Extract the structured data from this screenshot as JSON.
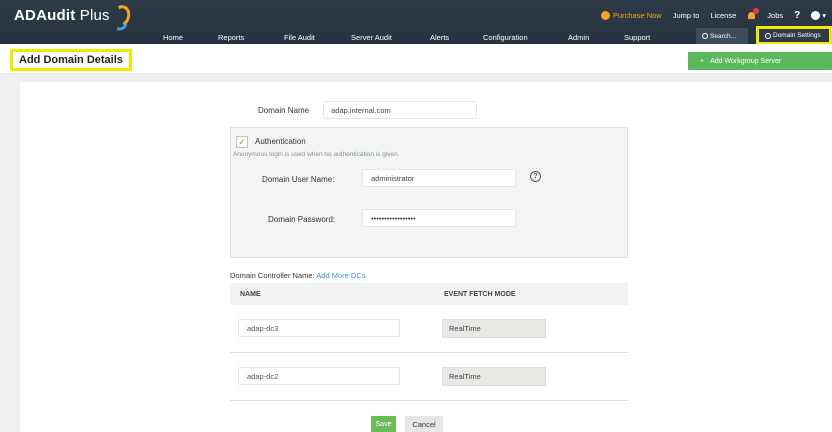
{
  "app": {
    "name": "ADAudit",
    "name_suffix": "Plus"
  },
  "utility": {
    "purchase": "Purchase Now",
    "jump_to": "Jump to",
    "license": "License",
    "jobs": "Jobs",
    "help": "?"
  },
  "nav": {
    "items": [
      "Home",
      "Reports",
      "File Audit",
      "Server Audit",
      "Alerts",
      "Configuration",
      "Admin",
      "Support"
    ],
    "search_label": "Search...",
    "domain_settings_label": "Domain Settings"
  },
  "page": {
    "title": "Add Domain Details",
    "add_workgroup_label": "Add Workgroup Server"
  },
  "form": {
    "domain_name_label": "Domain Name",
    "domain_name_value": "adap.internal.com",
    "auth_label": "Authentication",
    "auth_checked": true,
    "auth_hint": "Anonymous login is used when no authentication is given.",
    "user_label": "Domain User Name:",
    "user_value": "administrator",
    "password_label": "Domain Password:",
    "password_value": "•••••••••••••••••"
  },
  "dc": {
    "title": "Domain Controller Name:",
    "add_more_link": "Add More DCs",
    "col_name": "NAME",
    "col_mode": "EVENT FETCH MODE",
    "rows": [
      {
        "name": "adap-dc3",
        "mode": "RealTime"
      },
      {
        "name": "adap-dc2",
        "mode": "RealTime"
      }
    ]
  },
  "actions": {
    "save": "Save",
    "cancel": "Cancel"
  },
  "colors": {
    "topbar": "#2f3b49",
    "highlight": "#f3e800",
    "accent_green": "#5cb85c",
    "link": "#3d8ed6",
    "purchase": "#f5a623"
  }
}
